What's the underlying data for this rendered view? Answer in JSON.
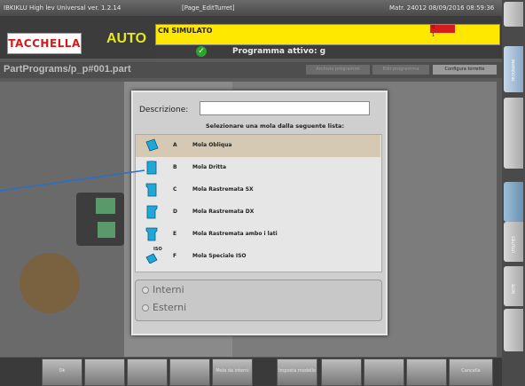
{
  "titlebar": {
    "app": "IBKIKLU High lev Universal  ver. 1.2.14",
    "page": "[Page_EditTurret]",
    "matr": "Matr. 24012  08/09/2016 08:59:36"
  },
  "header": {
    "logo": "TACCHELLA",
    "mode": "AUTO",
    "cn_status": "CN SIMULATO",
    "cell_red": "0",
    "cell_yellow": "1",
    "active_program": "Programma attivo: g"
  },
  "path": "PartPrograms/p_p#001.part",
  "breadcrumb": [
    "Archivio programmi",
    "Edit programma",
    "Configura torrette"
  ],
  "right_tabs": [
    "PROGRAMMI",
    "UTILITIES",
    "NOTE"
  ],
  "dialog": {
    "desc_label": "Descrizione:",
    "desc_value": "",
    "list_header": "Selezionare una mola dalla seguente lista:",
    "items": [
      {
        "letter": "A",
        "name": "Mola Obliqua",
        "icon": "oblique-wheel-icon",
        "selected": true
      },
      {
        "letter": "B",
        "name": "Mola Dritta",
        "icon": "straight-wheel-icon",
        "selected": false
      },
      {
        "letter": "C",
        "name": "Mola Rastremata SX",
        "icon": "tapered-left-wheel-icon",
        "selected": false
      },
      {
        "letter": "D",
        "name": "Mola Rastremata DX",
        "icon": "tapered-right-wheel-icon",
        "selected": false
      },
      {
        "letter": "E",
        "name": "Mola Rastremata ambo i lati",
        "icon": "tapered-both-wheel-icon",
        "selected": false
      },
      {
        "letter": "F",
        "name": "Mola Speciale ISO",
        "icon": "iso-wheel-icon",
        "selected": false
      }
    ],
    "iso_badge": "ISO",
    "radio_interni": "Interni",
    "radio_esterni": "Esterni"
  },
  "bottom_buttons": [
    "Ok",
    "",
    "",
    "",
    "Mola da interni",
    "Imposta modello",
    "",
    "",
    "",
    "",
    "Cancella"
  ],
  "colors": {
    "cn_bar": "#ffe800",
    "selected_row": "#d6c9b3",
    "icon": "#1ea8d8"
  }
}
